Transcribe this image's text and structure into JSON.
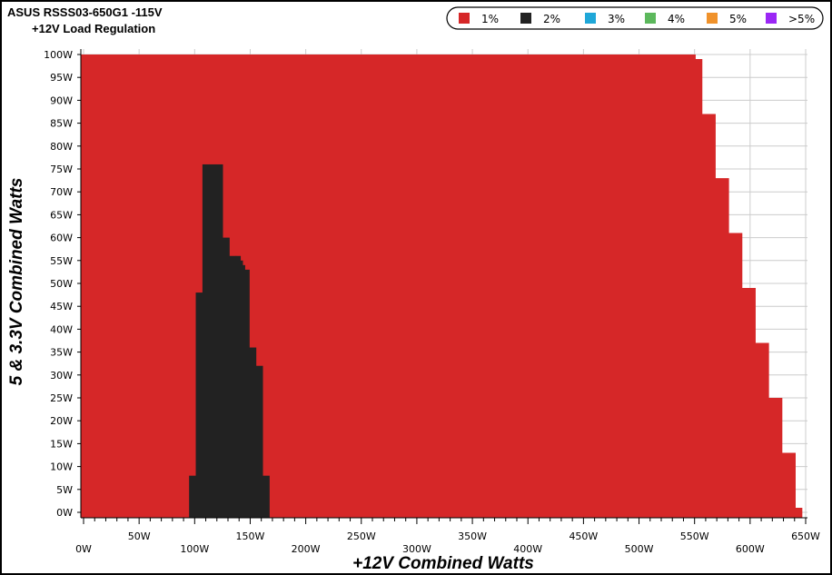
{
  "chart_data": {
    "type": "heatmap",
    "title": "ASUS RSSS03-650G1 -115V",
    "subtitle": "+12V Load Regulation",
    "xlabel": "+12V Combined Watts",
    "ylabel": "5 & 3.3V Combined Watts",
    "xlim": [
      0,
      650
    ],
    "ylim": [
      0,
      100
    ],
    "x_ticks": [
      0,
      50,
      100,
      150,
      200,
      250,
      300,
      350,
      400,
      450,
      500,
      550,
      600,
      650
    ],
    "x_tick_labels": [
      "0W",
      "50W",
      "100W",
      "150W",
      "200W",
      "250W",
      "300W",
      "350W",
      "400W",
      "450W",
      "500W",
      "550W",
      "600W",
      "650W"
    ],
    "y_ticks": [
      0,
      5,
      10,
      15,
      20,
      25,
      30,
      35,
      40,
      45,
      50,
      55,
      60,
      65,
      70,
      75,
      80,
      85,
      90,
      95,
      100
    ],
    "y_tick_labels": [
      "0W",
      "5W",
      "10W",
      "15W",
      "20W",
      "25W",
      "30W",
      "35W",
      "40W",
      "45W",
      "50W",
      "55W",
      "60W",
      "65W",
      "70W",
      "75W",
      "80W",
      "85W",
      "90W",
      "95W",
      "100W"
    ],
    "grid": true,
    "legend_position": "top-right",
    "legend": [
      {
        "label": "1%",
        "color": "#d62728"
      },
      {
        "label": "2%",
        "color": "#222222"
      },
      {
        "label": "3%",
        "color": "#1fa7d8"
      },
      {
        "label": "4%",
        "color": "#5cb85c"
      },
      {
        "label": "5%",
        "color": "#f0922b"
      },
      {
        "label": ">5%",
        "color": "#9b27f5"
      }
    ],
    "series": [
      {
        "name": "1%",
        "color": "#d62728",
        "boundary_x": [
          0,
          545,
          551,
          557,
          563,
          569,
          575,
          581,
          587,
          593,
          599,
          605,
          611,
          617,
          623,
          629,
          635,
          641,
          647
        ],
        "boundary_y": [
          100,
          100,
          99,
          87,
          87,
          73,
          73,
          61,
          61,
          49,
          49,
          37,
          37,
          25,
          25,
          13,
          13,
          1,
          0
        ]
      },
      {
        "name": "2%",
        "color": "#222222",
        "columns": [
          {
            "x0": 95,
            "x1": 101,
            "ymax": 8
          },
          {
            "x0": 101,
            "x1": 107,
            "ymax": 48
          },
          {
            "x0": 107,
            "x1": 113,
            "ymax": 76
          },
          {
            "x0": 113,
            "x1": 119,
            "ymax": 76
          },
          {
            "x0": 119,
            "x1": 125,
            "ymax": 76
          },
          {
            "x0": 125,
            "x1": 131,
            "ymax": 60
          },
          {
            "x0": 131,
            "x1": 137,
            "ymax": 56
          },
          {
            "x0": 137,
            "x1": 141,
            "ymax": 56
          },
          {
            "x0": 141,
            "x1": 143,
            "ymax": 55
          },
          {
            "x0": 143,
            "x1": 145,
            "ymax": 54
          },
          {
            "x0": 145,
            "x1": 149,
            "ymax": 53
          },
          {
            "x0": 149,
            "x1": 155,
            "ymax": 36
          },
          {
            "x0": 155,
            "x1": 161,
            "ymax": 32
          },
          {
            "x0": 161,
            "x1": 167,
            "ymax": 8
          }
        ]
      }
    ]
  }
}
